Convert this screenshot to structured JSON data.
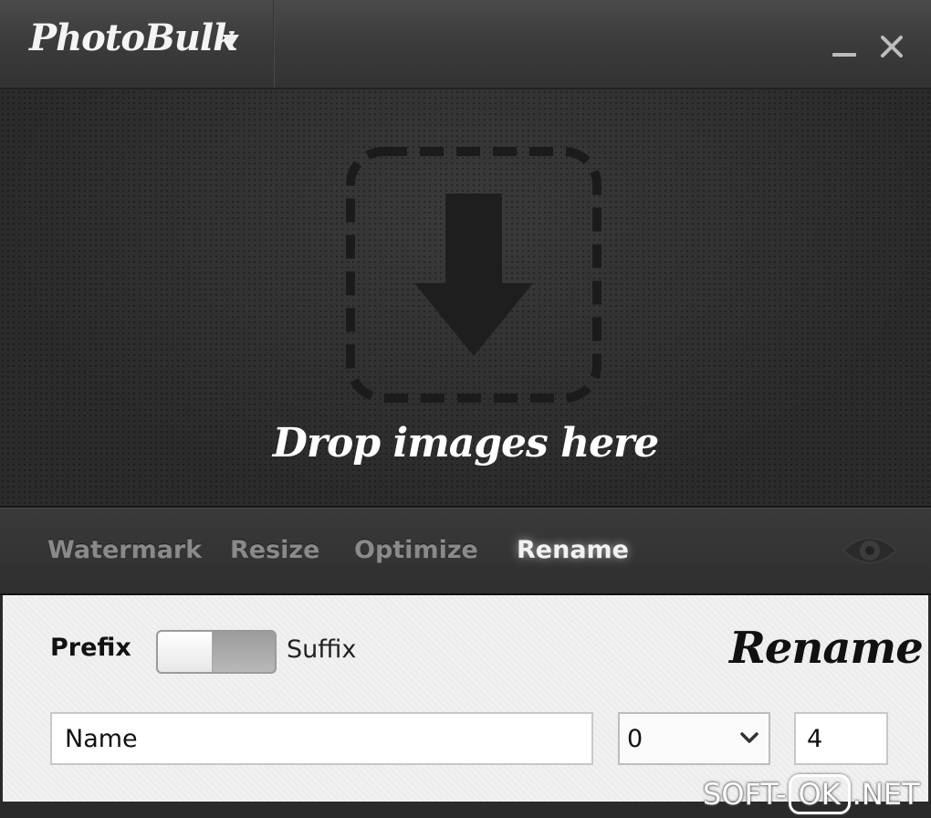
{
  "app": {
    "title": "PhotoBulk"
  },
  "dropzone": {
    "label": "Drop images here"
  },
  "tabs": [
    {
      "label": "Watermark",
      "active": false
    },
    {
      "label": "Resize",
      "active": false
    },
    {
      "label": "Optimize",
      "active": false
    },
    {
      "label": "Rename",
      "active": true
    }
  ],
  "rename": {
    "title": "Rename",
    "prefix_label": "Prefix",
    "suffix_label": "Suffix",
    "toggle_state": "prefix",
    "name_value": "Name",
    "start_select_value": "0",
    "digits_value": "4"
  },
  "watermark": {
    "part1": "SOFT-",
    "part2": "OK",
    "part3": ".NET"
  },
  "colors": {
    "titlebar": "#3e3e3e",
    "dropzone": "#2c2c2c",
    "panel": "#f1f1f1",
    "tab_active": "#f2f2f2",
    "tab_inactive": "#8a8a8a"
  },
  "icons": {
    "menu": "chevron-down-icon",
    "minimize": "minimize-icon",
    "close": "close-icon",
    "drop": "download-arrow-icon",
    "preview": "eye-icon",
    "select": "chevron-down-icon"
  }
}
